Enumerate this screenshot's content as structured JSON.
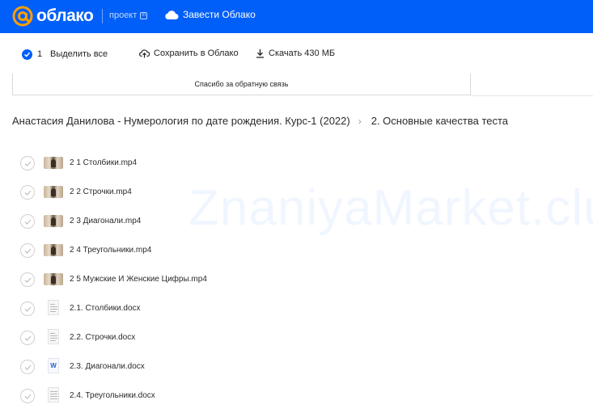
{
  "header": {
    "logo_text": "облако",
    "project_label": "проект",
    "project_badge": "m",
    "get_cloud_label": "Завести Облако",
    "brand_color": "#005ff9"
  },
  "toolbar": {
    "selected_count": "1",
    "select_all_label": "Выделить все",
    "save_label": "Сохранить в Облако",
    "download_label": "Скачать 430 МБ"
  },
  "feedback": {
    "text": "Спасибо за обратную связь"
  },
  "breadcrumb": {
    "parent": "Анастасия Данилова - Нумерология по дате рождения. Курс-1 (2022)",
    "current": "2. Основные качества теста"
  },
  "watermark": "ZnaniyaMarket.club",
  "files": [
    {
      "name": "2 1 Столбики.mp4",
      "type": "video"
    },
    {
      "name": "2 2 Строчки.mp4",
      "type": "video"
    },
    {
      "name": "2 3 Диагонали.mp4",
      "type": "video"
    },
    {
      "name": "2 4 Треугольники.mp4",
      "type": "video"
    },
    {
      "name": "2 5 Мужские И Женские Цифры.mp4",
      "type": "video"
    },
    {
      "name": "2.1. Столбики.docx",
      "type": "doc"
    },
    {
      "name": "2.2. Строчки.docx",
      "type": "doc"
    },
    {
      "name": "2.3. Диагонали.docx",
      "type": "word"
    },
    {
      "name": "2.4. Треугольники.docx",
      "type": "doc"
    }
  ]
}
